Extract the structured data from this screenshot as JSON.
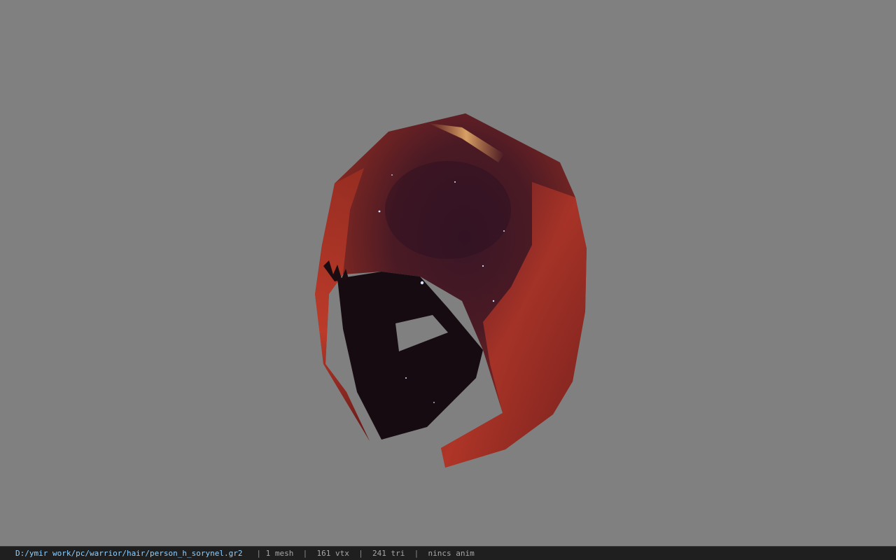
{
  "viewer": {
    "background_color": "#808080",
    "model_colors": {
      "dark": "#2a0d12",
      "mid": "#7a1f1c",
      "bright": "#c8442c",
      "highlight": "#e6a15a",
      "interior": "#140a10"
    }
  },
  "status": {
    "file_path": "D:/ymir work/pc/warrior/hair/person_h_sorynel.gr2",
    "separator": "|",
    "mesh": "1 mesh",
    "vertices": "161 vtx",
    "triangles": "241 tri",
    "anim": "nincs anim"
  }
}
